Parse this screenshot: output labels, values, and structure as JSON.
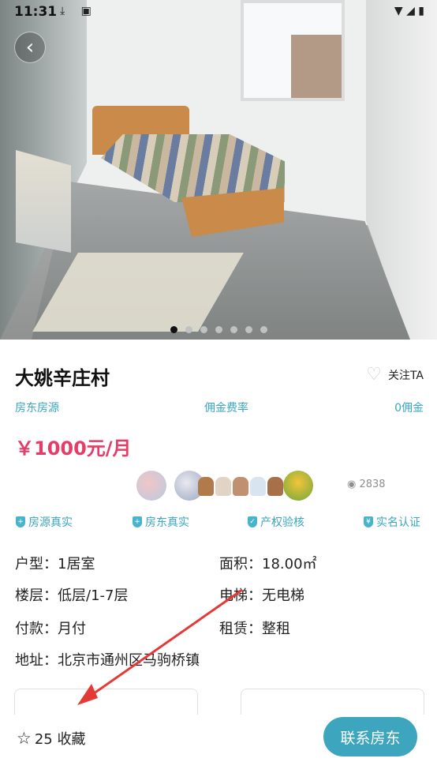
{
  "status_bar": {
    "time": "11:31"
  },
  "listing": {
    "title": "大姚辛庄村",
    "follow_label": "关注TA",
    "source_label": "房东房源",
    "commission_label": "佣金费率",
    "commission_value": "0佣金",
    "price": "￥1000元/月",
    "views": "2838"
  },
  "badges": [
    {
      "label": "房源真实"
    },
    {
      "label": "房东真实"
    },
    {
      "label": "产权验核"
    },
    {
      "label": "实名认证"
    }
  ],
  "details": {
    "layout": "户型：1居室",
    "area": "面积：18.00㎡",
    "floor": "楼层：低层/1-7层",
    "elevator": "电梯：无电梯",
    "payment": "付款：月付",
    "rent_type": "租赁：整租",
    "address": "地址：北京市通州区马驹桥镇"
  },
  "bottom": {
    "favorites": "25 收藏",
    "contact_button": "联系房东"
  },
  "photo": {
    "slide_count": 7,
    "active_slide": 1
  },
  "colors": {
    "accent": "#3da6be",
    "price": "#e33d68",
    "annotation_arrow": "#e53935"
  }
}
